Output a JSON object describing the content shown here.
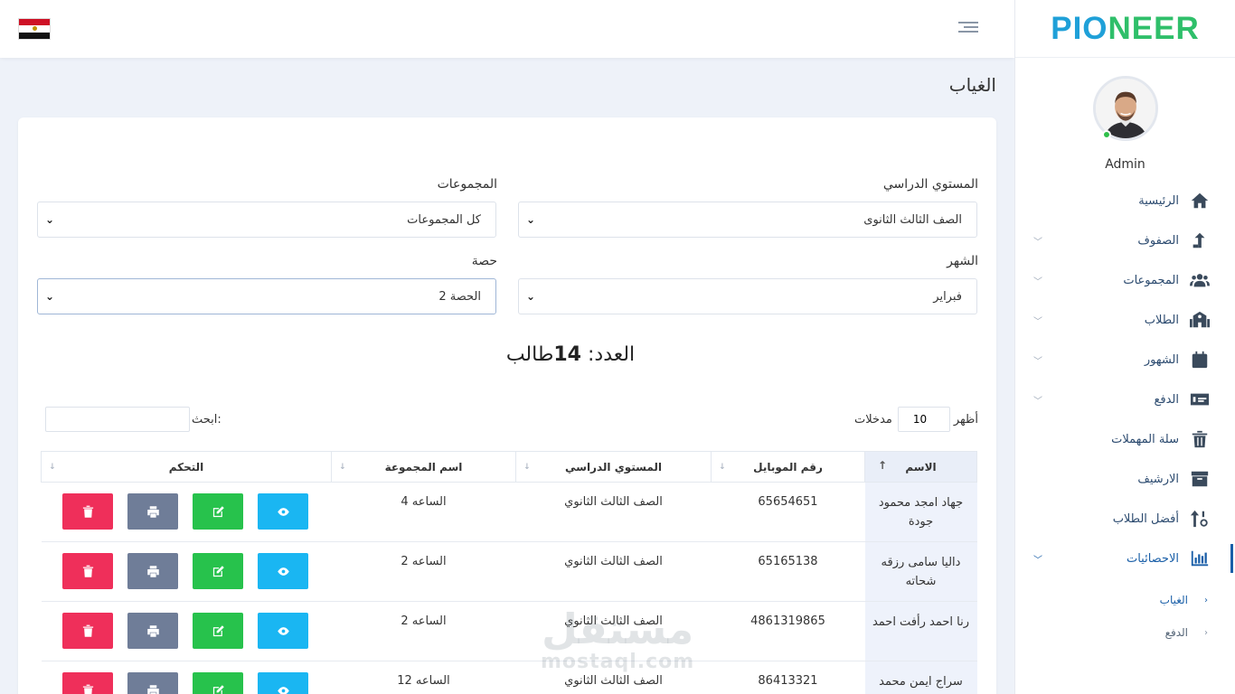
{
  "brand": {
    "part1": "PIO",
    "part2": "NEER"
  },
  "profile": {
    "name": "Admin"
  },
  "menu": [
    {
      "label": "الرئيسية",
      "icon": "home-icon",
      "chevron": false
    },
    {
      "label": "الصفوف",
      "icon": "arrow-up-icon",
      "chevron": true
    },
    {
      "label": "المجموعات",
      "icon": "users-icon",
      "chevron": true
    },
    {
      "label": "الطلاب",
      "icon": "school-icon",
      "chevron": true
    },
    {
      "label": "الشهور",
      "icon": "calendar-icon",
      "chevron": true
    },
    {
      "label": "الدفع",
      "icon": "money-icon",
      "chevron": true
    },
    {
      "label": "سلة المهملات",
      "icon": "trash-icon",
      "chevron": false
    },
    {
      "label": "الارشيف",
      "icon": "archive-icon",
      "chevron": false
    },
    {
      "label": "أفضل الطلاب",
      "icon": "sort-icon",
      "chevron": false
    },
    {
      "label": "الاحصائيات",
      "icon": "chart-icon",
      "chevron": true,
      "active": true
    }
  ],
  "submenu": [
    {
      "label": "الغياب",
      "active": true
    },
    {
      "label": "الدفع",
      "active": false
    }
  ],
  "page": {
    "title": "الغياب"
  },
  "filters": {
    "level_label": "المستوي الدراسي",
    "level_value": "الصف الثالث الثانوى",
    "groups_label": "المجموعات",
    "groups_value": "كل المجموعات",
    "month_label": "الشهر",
    "month_value": "فبراير",
    "session_label": "حصة",
    "session_value": "الحصة 2"
  },
  "count": {
    "prefix": "العدد:",
    "number": "14",
    "suffix": "طالب"
  },
  "table_controls": {
    "show_label": "أظهر",
    "show_value": "10",
    "entries_label": "مدخلات",
    "search_label": "ابحث:"
  },
  "table": {
    "headers": [
      "الاسم",
      "رقم الموبايل",
      "المستوي الدراسي",
      "اسم المجموعة",
      "التحكم"
    ],
    "rows": [
      {
        "name": "جهاد امجد محمود جودة",
        "phone": "65654651",
        "level": "الصف الثالث الثانوي",
        "group": "الساعه 4"
      },
      {
        "name": "داليا سامى رزقه شحاته",
        "phone": "65165138",
        "level": "الصف الثالث الثانوي",
        "group": "الساعه 2"
      },
      {
        "name": "رنا احمد رأفت احمد",
        "phone": "4861319865",
        "level": "الصف الثالث الثانوي",
        "group": "الساعه 2"
      },
      {
        "name": "سراج ايمن محمد",
        "phone": "86413321",
        "level": "الصف الثالث الثانوي",
        "group": "الساعه 12"
      }
    ]
  },
  "watermark": {
    "line1": "مستقل",
    "line2": "mostaql.com"
  },
  "colors": {
    "view": "#1ab6f2",
    "edit": "#27c24c",
    "print": "#6f7d98",
    "delete": "#ef2f5a",
    "accent": "#1a5fa8"
  }
}
